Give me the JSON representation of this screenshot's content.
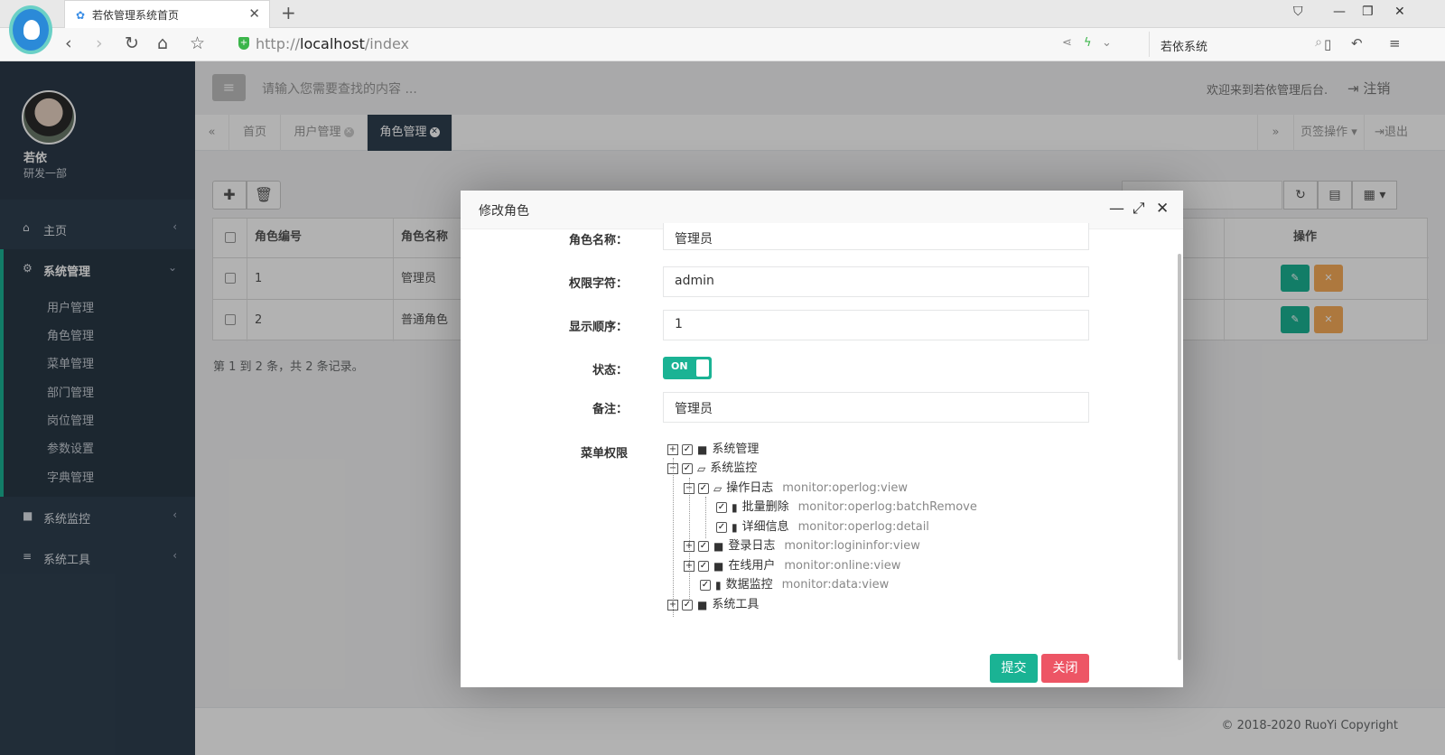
{
  "browser": {
    "tab_title": "若依管理系统首页",
    "url_scheme": "http://",
    "url_host": "localhost",
    "url_path": "/index",
    "search_text": "若依系统"
  },
  "sidebar": {
    "user_name": "若依",
    "user_dept": "研发一部",
    "menu": [
      {
        "label": "主页"
      },
      {
        "label": "系统管理"
      },
      {
        "label": "系统监控"
      },
      {
        "label": "系统工具"
      }
    ],
    "submenu": [
      "用户管理",
      "角色管理",
      "菜单管理",
      "部门管理",
      "岗位管理",
      "参数设置",
      "字典管理"
    ]
  },
  "header": {
    "search_placeholder": "请输入您需要查找的内容 ...",
    "welcome": "欢迎来到若依管理后台.",
    "logout": "注销"
  },
  "page_tabs": {
    "tabs": [
      "首页",
      "用户管理",
      "角色管理"
    ],
    "tab_actions": "页签操作",
    "exit": "退出"
  },
  "table": {
    "headers": [
      "角色编号",
      "角色名称",
      "操作"
    ],
    "rows": [
      {
        "id": "1",
        "name": "管理员"
      },
      {
        "id": "2",
        "name": "普通角色"
      }
    ],
    "page_info": "第 1 到 2 条，共 2 条记录。"
  },
  "modal": {
    "title": "修改角色",
    "fields": {
      "role_name_label": "角色名称：",
      "role_name_value": "管理员",
      "role_key_label": "权限字符：",
      "role_key_value": "admin",
      "sort_label": "显示顺序：",
      "sort_value": "1",
      "status_label": "状态：",
      "status_value": "ON",
      "remark_label": "备注：",
      "remark_value": "管理员",
      "menu_label": "菜单权限"
    },
    "tree": [
      {
        "label": "系统管理",
        "perm": ""
      },
      {
        "label": "系统监控",
        "perm": ""
      },
      {
        "label": "操作日志",
        "perm": "monitor:operlog:view"
      },
      {
        "label": "批量删除",
        "perm": "monitor:operlog:batchRemove"
      },
      {
        "label": "详细信息",
        "perm": "monitor:operlog:detail"
      },
      {
        "label": "登录日志",
        "perm": "monitor:logininfor:view"
      },
      {
        "label": "在线用户",
        "perm": "monitor:online:view"
      },
      {
        "label": "数据监控",
        "perm": "monitor:data:view"
      },
      {
        "label": "系统工具",
        "perm": ""
      }
    ],
    "submit": "提交",
    "close": "关闭"
  },
  "footer": {
    "copyright": "© 2018-2020 RuoYi Copyright"
  },
  "colors": {
    "sidebar_bg": "#2f4050",
    "accent": "#1ab394",
    "warning": "#f8ac59",
    "danger": "#ed5565"
  }
}
